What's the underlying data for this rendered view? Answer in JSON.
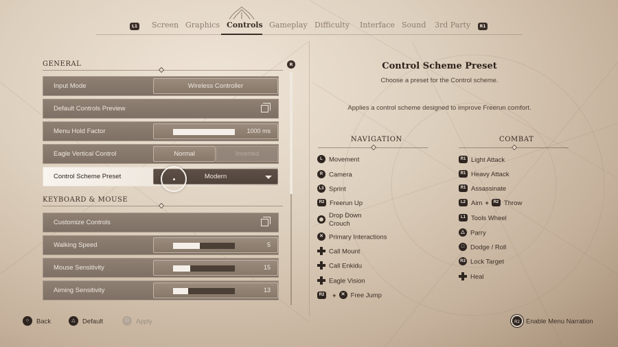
{
  "tabs": {
    "left_bumper": "L1",
    "right_bumper": "R1",
    "items": [
      "Screen",
      "Graphics",
      "Controls",
      "Gameplay",
      "Difficulty",
      "Interface",
      "Sound",
      "3rd Party"
    ],
    "active": "Controls"
  },
  "settings": {
    "scroll_badge": "R",
    "general_header": "GENERAL",
    "kbm_header": "KEYBOARD & MOUSE",
    "input_mode": {
      "label": "Input Mode",
      "value": "Wireless Controller"
    },
    "default_controls_preview": {
      "label": "Default Controls Preview"
    },
    "menu_hold_factor": {
      "label": "Menu Hold Factor",
      "value": "1000 ms",
      "fill": 1.0
    },
    "eagle_vertical_control": {
      "label": "Eagle Vertical Control",
      "option_a": "Normal",
      "option_b": "Inverted"
    },
    "control_scheme_preset": {
      "label": "Control Scheme Preset",
      "value": "Modern"
    },
    "customize_controls": {
      "label": "Customize Controls"
    },
    "walking_speed": {
      "label": "Walking Speed",
      "value": "5",
      "fill": 0.43
    },
    "mouse_sensitivity": {
      "label": "Mouse Sensitivity",
      "value": "15",
      "fill": 0.28
    },
    "aiming_sensitivity": {
      "label": "Aiming Sensitivity",
      "value": "13",
      "fill": 0.24
    }
  },
  "detail": {
    "title": "Control Scheme Preset",
    "subtitle": "Choose a preset for the Control scheme.",
    "description": "Applies a control scheme designed to improve Freerun comfort.",
    "navigation_header": "NAVIGATION",
    "combat_header": "COMBAT",
    "navigation": [
      {
        "button": "L",
        "label": "Movement"
      },
      {
        "button": "R",
        "label": "Camera"
      },
      {
        "button": "L3",
        "label": "Sprint"
      },
      {
        "button": "R2",
        "label": "Freerun Up"
      },
      {
        "button": "circle",
        "label": "Drop Down",
        "label2": "Crouch"
      },
      {
        "button": "cross",
        "label": "Primary Interactions"
      },
      {
        "button": "dpad",
        "label": "Call Mount"
      },
      {
        "button": "dpad",
        "label": "Call Enkidu"
      },
      {
        "button": "dpad",
        "label": "Eagle Vision"
      },
      {
        "button": "R2",
        "button2": "cross",
        "label": "Free Jump"
      }
    ],
    "combat": [
      {
        "button": "R1",
        "label": "Light Attack"
      },
      {
        "button": "R1",
        "label": "Heavy Attack"
      },
      {
        "button": "R1",
        "label": "Assassinate"
      },
      {
        "button": "L2",
        "button2": "R2",
        "label": "Aim",
        "label2": "Throw"
      },
      {
        "button": "L1",
        "label": "Tools Wheel"
      },
      {
        "button": "triangle",
        "label": "Parry"
      },
      {
        "button": "square",
        "label": "Dodge / Roll"
      },
      {
        "button": "R3",
        "label": "Lock Target"
      },
      {
        "button": "dpad",
        "label": "Heal"
      }
    ]
  },
  "footer": {
    "back": "Back",
    "default": "Default",
    "apply": "Apply",
    "narration": "Enable Menu Narration",
    "narration_button": "R2"
  }
}
